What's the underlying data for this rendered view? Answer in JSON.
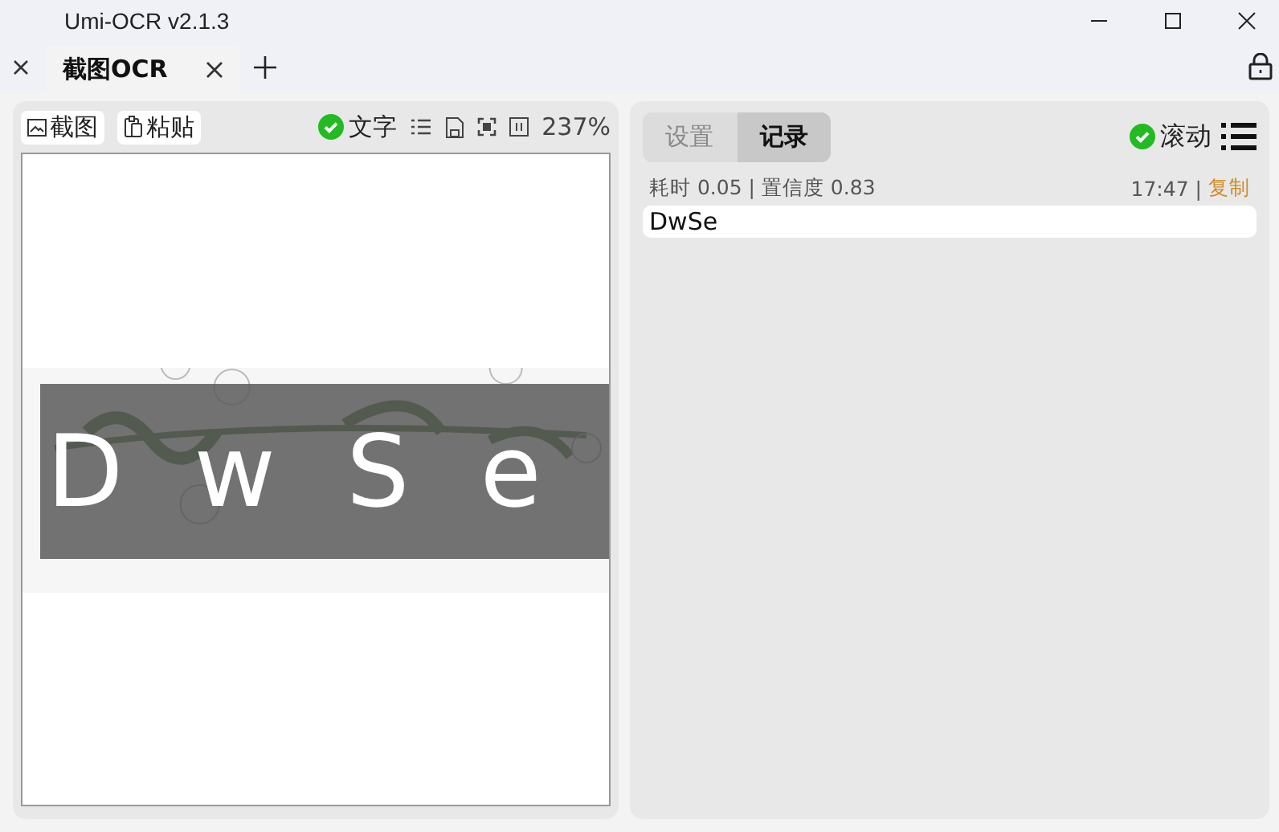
{
  "window": {
    "title": "Umi-OCR v2.1.3"
  },
  "tabs": [
    {
      "label": "截图OCR",
      "selected": true
    }
  ],
  "left_panel": {
    "buttons": [
      {
        "label": "截图",
        "kind": "screenshot"
      },
      {
        "label": "粘贴",
        "kind": "paste"
      }
    ],
    "text_toggle": {
      "label": "文字",
      "checked": true
    },
    "zoom": "237%",
    "image": {
      "kind": "picture",
      "overlay_text": "DwSe"
    }
  },
  "right_panel": {
    "tabs": [
      {
        "label": "设置",
        "selected": false
      },
      {
        "label": "记录",
        "selected": true
      }
    ],
    "scroll_toggle": {
      "label": "滚动",
      "checked": true
    },
    "records": [
      {
        "stats": "耗时 0.05 | 置信度 0.83",
        "time": "17:47",
        "separator": "|",
        "copy": "复制",
        "text": "DwSe"
      }
    ]
  }
}
